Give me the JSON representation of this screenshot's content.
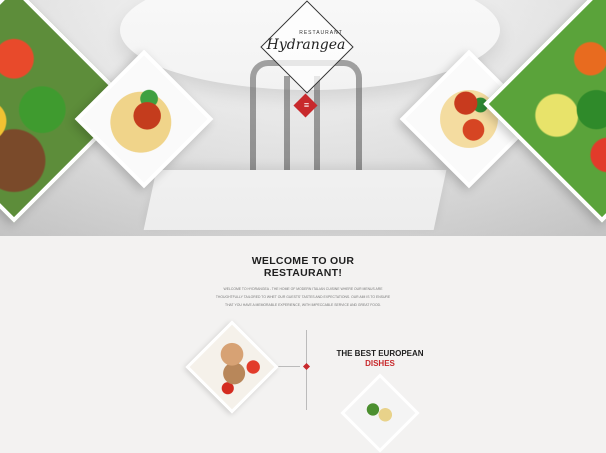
{
  "brand": {
    "small_label": "RESTAURANT",
    "name": "Hydrangea"
  },
  "hero": {
    "menu_icon": "≡"
  },
  "welcome": {
    "title_line1": "WELCOME TO OUR",
    "title_line2": "RESTAURANT!",
    "body": "Welcome to Hydrangea - the home of modern Italian cuisine where our menus are thoughtfully tailored to whet our guests' tastes and expectations. Our aim is to ensure that you have a memorable experience, with impeccable service and great food."
  },
  "feature": {
    "line1": "THE BEST EUROPEAN",
    "line2": "DISHES"
  },
  "colors": {
    "accent": "#c8292c",
    "background": "#f3f2f1"
  }
}
